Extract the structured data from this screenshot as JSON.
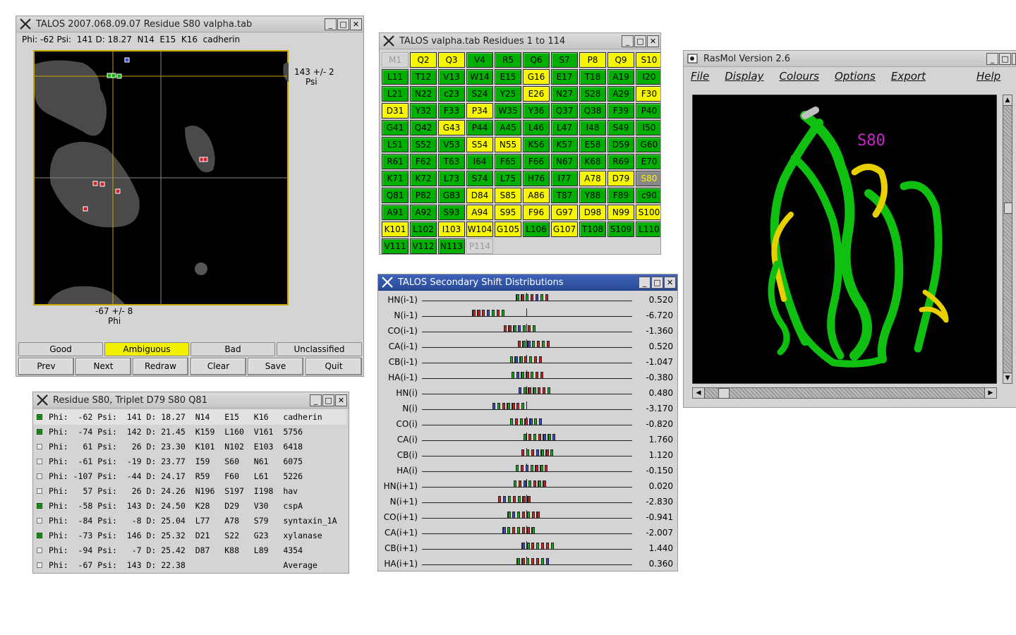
{
  "talos_main": {
    "title": "TALOS 2007.068.09.07  Residue S80 valpha.tab",
    "info": "Phi: -62 Psi:  141 D: 18.27  N14  E15  K16  cadherin",
    "psi_label": "143 +/- 2",
    "psi_axis": "Psi",
    "phi_label": "-67 +/- 8",
    "phi_axis": "Phi",
    "class_buttons": [
      "Good",
      "Ambiguous",
      "Bad",
      "Unclassified"
    ],
    "selected_class": "Ambiguous",
    "action_buttons": [
      "Prev",
      "Next",
      "Redraw",
      "Clear",
      "Save",
      "Quit"
    ]
  },
  "residues": {
    "title": "TALOS valpha.tab Residues 1 to 114",
    "cells": [
      {
        "l": "M1",
        "c": "n"
      },
      {
        "l": "Q2",
        "c": "y"
      },
      {
        "l": "Q3",
        "c": "y"
      },
      {
        "l": "V4",
        "c": "g"
      },
      {
        "l": "R5",
        "c": "g"
      },
      {
        "l": "Q6",
        "c": "g"
      },
      {
        "l": "S7",
        "c": "g"
      },
      {
        "l": "P8",
        "c": "y"
      },
      {
        "l": "Q9",
        "c": "y"
      },
      {
        "l": "S10",
        "c": "y"
      },
      {
        "l": "L11",
        "c": "g"
      },
      {
        "l": "T12",
        "c": "g"
      },
      {
        "l": "V13",
        "c": "g"
      },
      {
        "l": "W14",
        "c": "g"
      },
      {
        "l": "E15",
        "c": "g"
      },
      {
        "l": "G16",
        "c": "y"
      },
      {
        "l": "E17",
        "c": "g"
      },
      {
        "l": "T18",
        "c": "g"
      },
      {
        "l": "A19",
        "c": "g"
      },
      {
        "l": "I20",
        "c": "g"
      },
      {
        "l": "L21",
        "c": "g"
      },
      {
        "l": "N22",
        "c": "g"
      },
      {
        "l": "c23",
        "c": "g"
      },
      {
        "l": "S24",
        "c": "g"
      },
      {
        "l": "Y25",
        "c": "g"
      },
      {
        "l": "E26",
        "c": "y"
      },
      {
        "l": "N27",
        "c": "g"
      },
      {
        "l": "S28",
        "c": "g"
      },
      {
        "l": "A29",
        "c": "g"
      },
      {
        "l": "F30",
        "c": "y"
      },
      {
        "l": "D31",
        "c": "y"
      },
      {
        "l": "Y32",
        "c": "g"
      },
      {
        "l": "F33",
        "c": "g"
      },
      {
        "l": "P34",
        "c": "y"
      },
      {
        "l": "W35",
        "c": "g"
      },
      {
        "l": "Y36",
        "c": "g"
      },
      {
        "l": "Q37",
        "c": "g"
      },
      {
        "l": "Q38",
        "c": "g"
      },
      {
        "l": "F39",
        "c": "g"
      },
      {
        "l": "P40",
        "c": "g"
      },
      {
        "l": "G41",
        "c": "g"
      },
      {
        "l": "Q42",
        "c": "g"
      },
      {
        "l": "G43",
        "c": "y"
      },
      {
        "l": "P44",
        "c": "g"
      },
      {
        "l": "A45",
        "c": "g"
      },
      {
        "l": "L46",
        "c": "g"
      },
      {
        "l": "L47",
        "c": "g"
      },
      {
        "l": "I48",
        "c": "g"
      },
      {
        "l": "S49",
        "c": "g"
      },
      {
        "l": "I50",
        "c": "g"
      },
      {
        "l": "L51",
        "c": "g"
      },
      {
        "l": "S52",
        "c": "g"
      },
      {
        "l": "V53",
        "c": "g"
      },
      {
        "l": "S54",
        "c": "y"
      },
      {
        "l": "N55",
        "c": "y"
      },
      {
        "l": "K56",
        "c": "g"
      },
      {
        "l": "K57",
        "c": "g"
      },
      {
        "l": "E58",
        "c": "g"
      },
      {
        "l": "D59",
        "c": "g"
      },
      {
        "l": "G60",
        "c": "g"
      },
      {
        "l": "R61",
        "c": "g"
      },
      {
        "l": "F62",
        "c": "g"
      },
      {
        "l": "T63",
        "c": "g"
      },
      {
        "l": "I64",
        "c": "g"
      },
      {
        "l": "F65",
        "c": "g"
      },
      {
        "l": "F66",
        "c": "g"
      },
      {
        "l": "N67",
        "c": "g"
      },
      {
        "l": "K68",
        "c": "g"
      },
      {
        "l": "R69",
        "c": "g"
      },
      {
        "l": "E70",
        "c": "g"
      },
      {
        "l": "K71",
        "c": "g"
      },
      {
        "l": "K72",
        "c": "g"
      },
      {
        "l": "L73",
        "c": "g"
      },
      {
        "l": "S74",
        "c": "g"
      },
      {
        "l": "L75",
        "c": "g"
      },
      {
        "l": "H76",
        "c": "g"
      },
      {
        "l": "I77",
        "c": "g"
      },
      {
        "l": "A78",
        "c": "y"
      },
      {
        "l": "D79",
        "c": "y"
      },
      {
        "l": "S80",
        "c": "s"
      },
      {
        "l": "Q81",
        "c": "g"
      },
      {
        "l": "P82",
        "c": "g"
      },
      {
        "l": "G83",
        "c": "g"
      },
      {
        "l": "D84",
        "c": "y"
      },
      {
        "l": "S85",
        "c": "y"
      },
      {
        "l": "A86",
        "c": "y"
      },
      {
        "l": "T87",
        "c": "g"
      },
      {
        "l": "Y88",
        "c": "g"
      },
      {
        "l": "F89",
        "c": "g"
      },
      {
        "l": "c90",
        "c": "g"
      },
      {
        "l": "A91",
        "c": "g"
      },
      {
        "l": "A92",
        "c": "g"
      },
      {
        "l": "S93",
        "c": "g"
      },
      {
        "l": "A94",
        "c": "y"
      },
      {
        "l": "S95",
        "c": "y"
      },
      {
        "l": "F96",
        "c": "y"
      },
      {
        "l": "G97",
        "c": "y"
      },
      {
        "l": "D98",
        "c": "y"
      },
      {
        "l": "N99",
        "c": "y"
      },
      {
        "l": "S100",
        "c": "y"
      },
      {
        "l": "K101",
        "c": "y"
      },
      {
        "l": "L102",
        "c": "g"
      },
      {
        "l": "I103",
        "c": "y"
      },
      {
        "l": "W104",
        "c": "y"
      },
      {
        "l": "G105",
        "c": "y"
      },
      {
        "l": "L106",
        "c": "g"
      },
      {
        "l": "G107",
        "c": "y"
      },
      {
        "l": "T108",
        "c": "g"
      },
      {
        "l": "S109",
        "c": "g"
      },
      {
        "l": "L110",
        "c": "g"
      },
      {
        "l": "V111",
        "c": "g"
      },
      {
        "l": "V112",
        "c": "g"
      },
      {
        "l": "N113",
        "c": "g"
      },
      {
        "l": "P114",
        "c": "n"
      }
    ]
  },
  "triplet": {
    "title": "Residue S80, Triplet D79 S80 Q81",
    "rows": [
      {
        "checked": true,
        "text": "Phi:  -62 Psi:  141 D: 18.27  N14   E15   K16   cadherin"
      },
      {
        "checked": true,
        "text": "Phi:  -74 Psi:  142 D: 21.45  K159  L160  V161  5756"
      },
      {
        "checked": false,
        "text": "Phi:   61 Psi:   26 D: 23.30  K101  N102  E103  6418"
      },
      {
        "checked": false,
        "text": "Phi:  -61 Psi:  -19 D: 23.77  I59   S60   N61   6075"
      },
      {
        "checked": false,
        "text": "Phi: -107 Psi:  -44 D: 24.17  R59   F60   L61   5226"
      },
      {
        "checked": false,
        "text": "Phi:   57 Psi:   26 D: 24.26  N196  S197  I198  hav"
      },
      {
        "checked": true,
        "text": "Phi:  -58 Psi:  143 D: 24.50  K28   D29   V30   cspA"
      },
      {
        "checked": false,
        "text": "Phi:  -84 Psi:   -8 D: 25.04  L77   A78   S79   syntaxin_1A"
      },
      {
        "checked": true,
        "text": "Phi:  -73 Psi:  146 D: 25.32  D21   S22   G23   xylanase"
      },
      {
        "checked": false,
        "text": "Phi:  -94 Psi:   -7 D: 25.42  D87   K88   L89   4354"
      },
      {
        "checked": false,
        "text": "Phi:  -67 Psi:  143 D: 22.38                    Average"
      }
    ]
  },
  "shifts": {
    "title": "TALOS Secondary Shift Distributions",
    "rows": [
      {
        "label": "HN(i-1)",
        "value": "0.520"
      },
      {
        "label": "N(i-1)",
        "value": "-6.720"
      },
      {
        "label": "CO(i-1)",
        "value": "-1.360"
      },
      {
        "label": "CA(i-1)",
        "value": "0.520"
      },
      {
        "label": "CB(i-1)",
        "value": "-1.047"
      },
      {
        "label": "HA(i-1)",
        "value": "-0.380"
      },
      {
        "label": "HN(i)",
        "value": "0.480"
      },
      {
        "label": "N(i)",
        "value": "-3.170"
      },
      {
        "label": "CO(i)",
        "value": "-0.820"
      },
      {
        "label": "CA(i)",
        "value": "1.760"
      },
      {
        "label": "CB(i)",
        "value": "1.120"
      },
      {
        "label": "HA(i)",
        "value": "-0.150"
      },
      {
        "label": "HN(i+1)",
        "value": "0.020"
      },
      {
        "label": "N(i+1)",
        "value": "-2.830"
      },
      {
        "label": "CO(i+1)",
        "value": "-0.941"
      },
      {
        "label": "CA(i+1)",
        "value": "-2.007"
      },
      {
        "label": "CB(i+1)",
        "value": "1.440"
      },
      {
        "label": "HA(i+1)",
        "value": "0.360"
      }
    ],
    "colors": {
      "red": "#d42020",
      "green": "#10b010",
      "blue": "#3a4ad0"
    }
  },
  "rasmol": {
    "title": "RasMol Version 2.6",
    "menus": [
      "File",
      "Display",
      "Colours",
      "Options",
      "Export",
      "Help"
    ],
    "label": "S80",
    "label_color": "#d020d0",
    "ribbon_color": "#10c010",
    "helix_color": "#e8d000"
  }
}
